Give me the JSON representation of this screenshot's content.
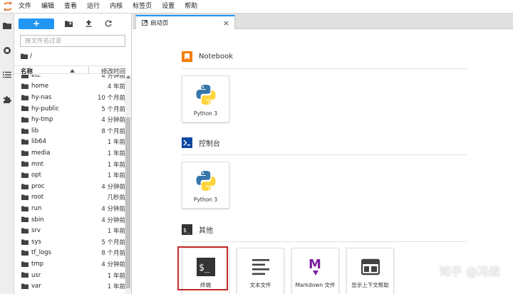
{
  "menubar": {
    "items": [
      "文件",
      "编辑",
      "查看",
      "运行",
      "内核",
      "标签页",
      "设置",
      "帮助"
    ]
  },
  "activity": {
    "icons": [
      "folder-icon",
      "running-icon",
      "list-icon",
      "puzzle-icon"
    ]
  },
  "browser": {
    "new_label": "+",
    "filter_placeholder": "按文件名过滤",
    "breadcrumb": "/",
    "col_name": "名称",
    "col_modified": "修改时间",
    "files": [
      {
        "name": "etc",
        "modified": "4 分钟前"
      },
      {
        "name": "home",
        "modified": "4 年前"
      },
      {
        "name": "hy-nas",
        "modified": "10 个月前"
      },
      {
        "name": "hy-public",
        "modified": "5 个月前"
      },
      {
        "name": "hy-tmp",
        "modified": "4 分钟前"
      },
      {
        "name": "lib",
        "modified": "8 个月前"
      },
      {
        "name": "lib64",
        "modified": "1 年前"
      },
      {
        "name": "media",
        "modified": "1 年前"
      },
      {
        "name": "mnt",
        "modified": "1 年前"
      },
      {
        "name": "opt",
        "modified": "1 年前"
      },
      {
        "name": "proc",
        "modified": "4 分钟前"
      },
      {
        "name": "root",
        "modified": "几秒前"
      },
      {
        "name": "run",
        "modified": "4 分钟前"
      },
      {
        "name": "sbin",
        "modified": "4 分钟前"
      },
      {
        "name": "srv",
        "modified": "1 年前"
      },
      {
        "name": "sys",
        "modified": "5 个月前"
      },
      {
        "name": "tf_logs",
        "modified": "8 个月前"
      },
      {
        "name": "tmp",
        "modified": "4 分钟前"
      },
      {
        "name": "usr",
        "modified": "1 年前"
      },
      {
        "name": "var",
        "modified": "1 年前"
      }
    ]
  },
  "tab": {
    "label": "启动页",
    "close": "×"
  },
  "launcher": {
    "notebook_title": "Notebook",
    "console_title": "控制台",
    "other_title": "其他",
    "notebook_card": "Python 3",
    "console_card": "Python 3",
    "other_cards": [
      "终端",
      "文本文件",
      "Markdown 文件",
      "显示上下文帮助"
    ]
  },
  "watermark": "知乎 @冯维",
  "colors": {
    "accent": "#2196f3",
    "highlight": "#c62828",
    "notebook_orange": "#f57c00",
    "console_blue": "#0d47a1",
    "markdown_purple": "#7b1fa2"
  }
}
